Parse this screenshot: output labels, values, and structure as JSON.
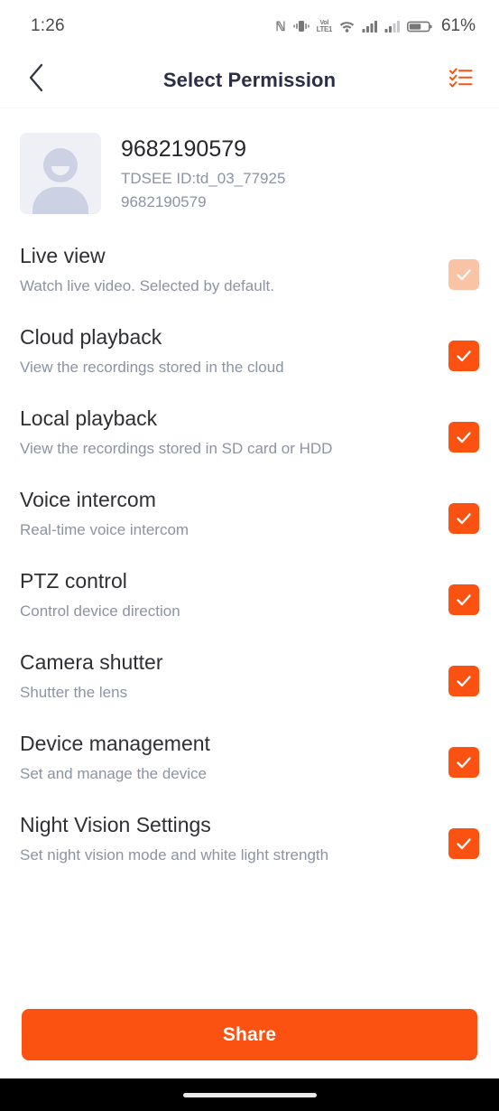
{
  "status_bar": {
    "time": "1:26",
    "battery_percent": "61%",
    "icons": [
      "nfc-icon",
      "vibrate-icon",
      "volte-icon",
      "wifi-icon",
      "signal-icon-1",
      "signal-icon-2",
      "battery-icon"
    ],
    "volte_line1": "Vol",
    "volte_line2": "LTE1"
  },
  "header": {
    "title": "Select Permission",
    "back_icon": "chevron-left-icon",
    "action_icon": "checklist-icon"
  },
  "profile": {
    "name": "9682190579",
    "tdsee_id": "TDSEE ID:td_03_77925",
    "phone": "9682190579",
    "avatar_icon": "person-placeholder-icon"
  },
  "permissions": [
    {
      "title": "Live view",
      "description": "Watch live video. Selected by default.",
      "checked": true,
      "disabled": true
    },
    {
      "title": "Cloud playback",
      "description": "View the recordings stored in the cloud",
      "checked": true,
      "disabled": false
    },
    {
      "title": "Local playback",
      "description": "View the recordings stored in SD card or HDD",
      "checked": true,
      "disabled": false
    },
    {
      "title": "Voice intercom",
      "description": "Real-time voice intercom",
      "checked": true,
      "disabled": false
    },
    {
      "title": "PTZ control",
      "description": "Control device direction",
      "checked": true,
      "disabled": false
    },
    {
      "title": "Camera shutter",
      "description": "Shutter the lens",
      "checked": true,
      "disabled": false
    },
    {
      "title": "Device management",
      "description": "Set and manage the device",
      "checked": true,
      "disabled": false
    },
    {
      "title": "Night Vision Settings",
      "description": "Set night vision mode and white light strength",
      "checked": true,
      "disabled": false
    }
  ],
  "footer": {
    "share_label": "Share"
  },
  "colors": {
    "accent": "#fb5212",
    "accent_disabled": "#fac3a5",
    "title_text": "#2b2e44",
    "body_text": "#2f3033",
    "muted_text": "#8c93a3",
    "nav_bar": "#000000"
  }
}
